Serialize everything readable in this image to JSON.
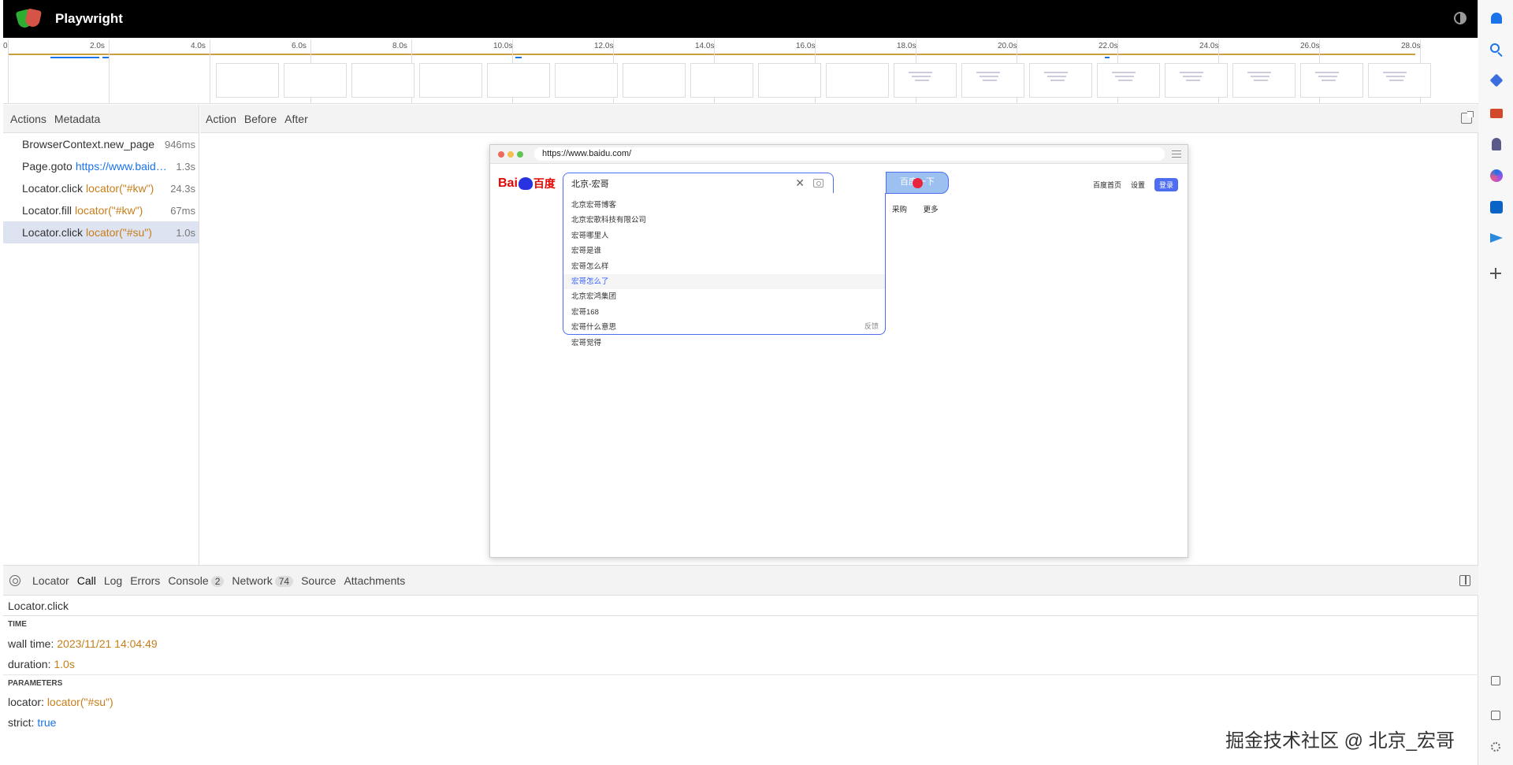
{
  "app": {
    "title": "Playwright"
  },
  "timeline": {
    "ticks": [
      "0",
      "2.0s",
      "4.0s",
      "6.0s",
      "8.0s",
      "10.0s",
      "12.0s",
      "14.0s",
      "16.0s",
      "18.0s",
      "20.0s",
      "22.0s",
      "24.0s",
      "26.0s",
      "28.0s"
    ]
  },
  "left_tabs": {
    "actions": "Actions",
    "metadata": "Metadata"
  },
  "actions": [
    {
      "name": "BrowserContext.new_page",
      "arg": "",
      "time": "946ms"
    },
    {
      "name": "Page.goto",
      "arg": "https://www.baidu.com/",
      "time": "1.3s"
    },
    {
      "name": "Locator.click",
      "arg": "locator(\"#kw\")",
      "time": "24.3s"
    },
    {
      "name": "Locator.fill",
      "arg": "locator(\"#kw\")",
      "time": "67ms"
    },
    {
      "name": "Locator.click",
      "arg": "locator(\"#su\")",
      "time": "1.0s"
    }
  ],
  "snapshot_tabs": {
    "action": "Action",
    "before": "Before",
    "after": "After"
  },
  "snapshot": {
    "url": "https://www.baidu.com/",
    "logo_text": "Bai",
    "logo_cn": "百度",
    "search_value": "北京-宏哥",
    "button_label": "百度一下",
    "suggestions": [
      "北京宏哥博客",
      "北京宏歌科技有限公司",
      "宏哥哪里人",
      "宏哥是谁",
      "宏哥怎么样",
      "宏哥怎么了",
      "北京宏鸿集团",
      "宏哥168",
      "宏哥什么意思",
      "宏哥觉得"
    ],
    "feedback": "反馈",
    "top_links": {
      "home": "百度首页",
      "settings": "设置",
      "login": "登录"
    },
    "nav_links": [
      "采购",
      "更多"
    ]
  },
  "bottom_tabs": {
    "locator": "Locator",
    "call": "Call",
    "log": "Log",
    "errors": "Errors",
    "console": "Console",
    "console_count": "2",
    "network": "Network",
    "network_count": "74",
    "source": "Source",
    "attachments": "Attachments"
  },
  "call": {
    "title": "Locator.click",
    "time_header": "TIME",
    "wall_time_label": "wall time:",
    "wall_time": "2023/11/21 14:04:49",
    "duration_label": "duration:",
    "duration": "1.0s",
    "params_header": "PARAMETERS",
    "locator_label": "locator:",
    "locator": "locator(\"#su\")",
    "strict_label": "strict:",
    "strict": "true"
  },
  "watermark": "掘金技术社区 @ 北京_宏哥",
  "colors": {
    "accent": "#1a73e8",
    "arg": "#c67e1a",
    "baidu_blue": "#4e6ef2",
    "baidu_red": "#e10602"
  }
}
